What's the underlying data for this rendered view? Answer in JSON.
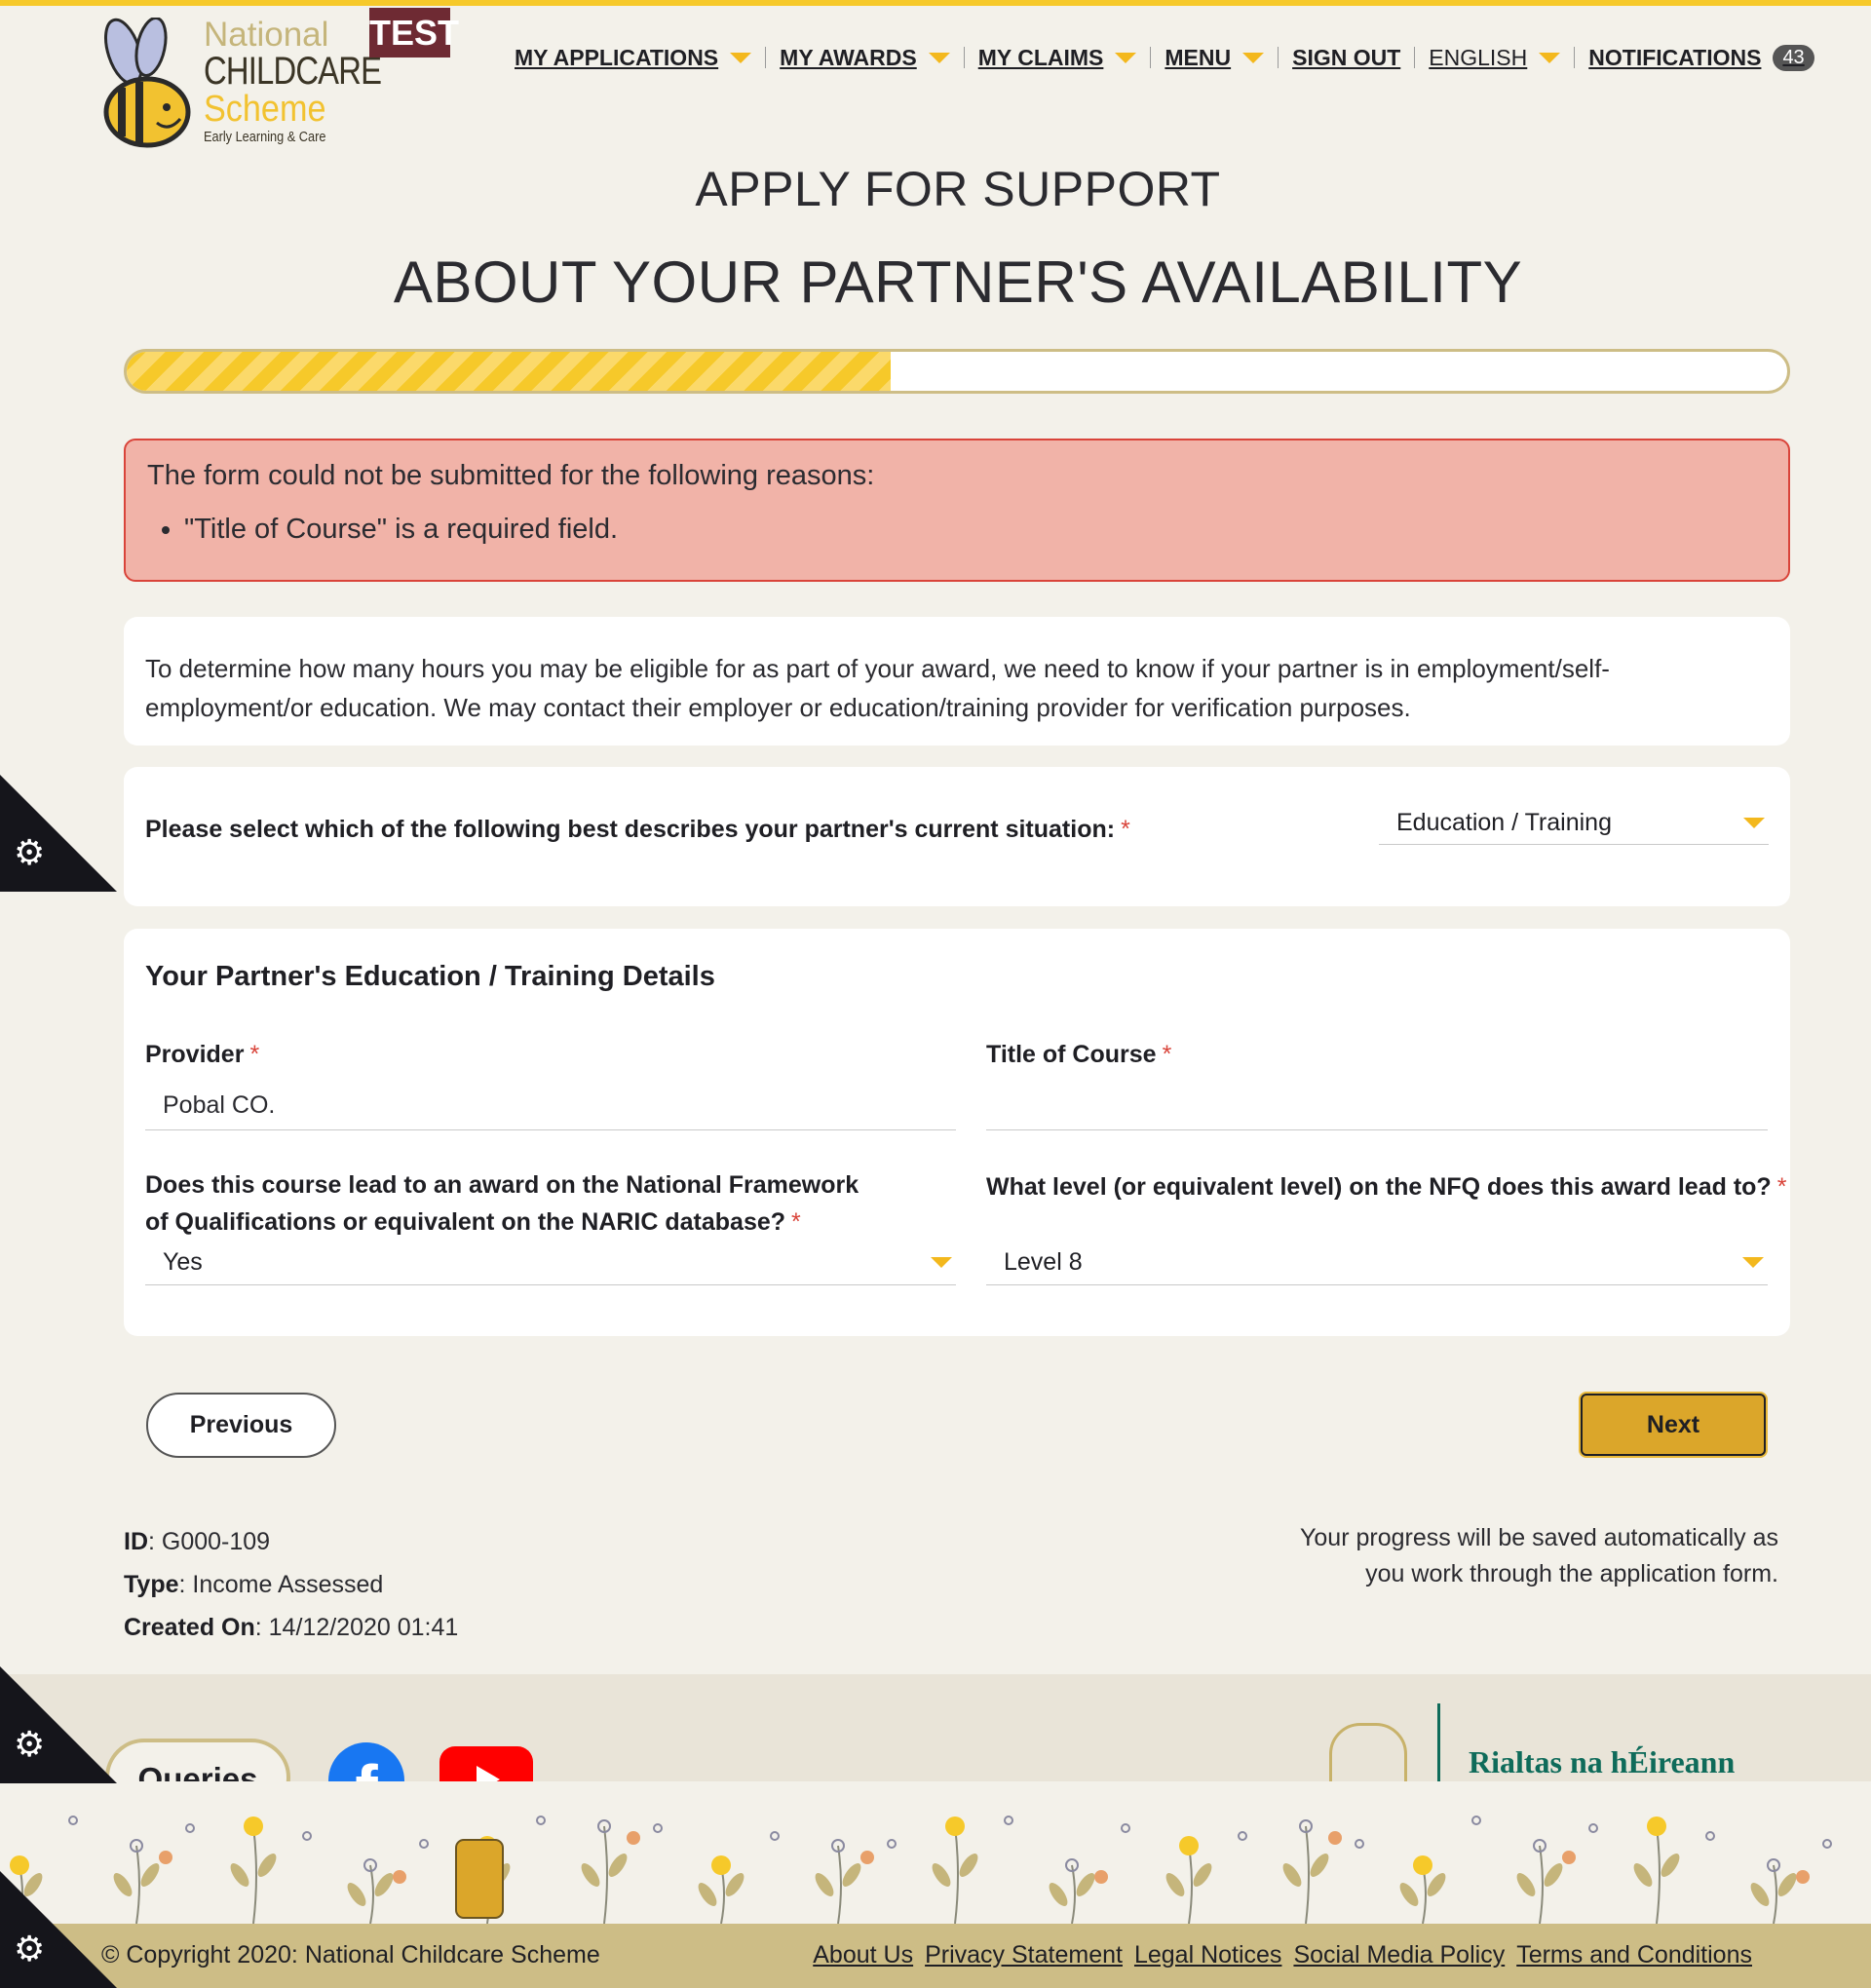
{
  "header": {
    "logo": {
      "line1": "National",
      "line2": "CHILDCARE",
      "line3": "Scheme",
      "line4": "Early Learning & Care"
    },
    "env_badge": "TEST",
    "nav": [
      {
        "label": "MY APPLICATIONS",
        "has_caret": true
      },
      {
        "label": "MY AWARDS",
        "has_caret": true
      },
      {
        "label": "MY CLAIMS",
        "has_caret": true
      },
      {
        "label": "MENU",
        "has_caret": true
      },
      {
        "label": "SIGN OUT",
        "has_caret": false
      },
      {
        "label": "ENGLISH",
        "has_caret": true
      },
      {
        "label": "NOTIFICATIONS",
        "has_caret": false
      }
    ],
    "notifications_count": "43"
  },
  "page": {
    "title": "APPLY FOR SUPPORT",
    "subtitle": "ABOUT YOUR PARTNER'S AVAILABILITY",
    "progress_percent": 46
  },
  "error": {
    "heading": "The form could not be submitted for the following reasons:",
    "items": [
      "\"Title of Course\" is a required field."
    ]
  },
  "intro": "To determine how many hours you may be eligible for as part of your award, we need to know if your partner is in employment/self-employment/or education. We may contact their employer or education/training provider for verification purposes.",
  "situation": {
    "label": "Please select which of the following best describes your partner's current situation:",
    "required_mark": "*",
    "value": "Education / Training"
  },
  "education": {
    "section_title": "Your Partner's Education / Training Details",
    "provider_label": "Provider",
    "provider_value": "Pobal CO.",
    "course_label": "Title of Course",
    "course_value": "",
    "nfq_award_label": "Does this course lead to an award on the National Framework of Qualifications or equivalent on the NARIC database?",
    "nfq_award_value": "Yes",
    "nfq_level_label": "What level (or equivalent level) on the NFQ does this award lead to?",
    "nfq_level_value": "Level 8",
    "required_mark": "*"
  },
  "buttons": {
    "previous": "Previous",
    "next": "Next"
  },
  "meta": {
    "id_label": "ID",
    "id_value": ": G000-109",
    "type_label": "Type",
    "type_value": ": Income Assessed",
    "created_label": "Created On",
    "created_value": ": 14/12/2020 01:41"
  },
  "saved_note": "Your progress will be saved automatically as you work through the application form.",
  "footer": {
    "queries": "Queries",
    "facebook_glyph": "f",
    "gov_text": "Rialtas na hÉireann",
    "copyright": "© Copyright 2020: National Childcare Scheme",
    "links": [
      "About Us",
      "Privacy Statement",
      "Legal Notices",
      "Social Media Policy",
      "Terms and Conditions"
    ]
  },
  "icons": {
    "accessibility": "gear-icon",
    "caret": "chevron-down-icon"
  },
  "colors": {
    "accent_yellow": "#f6c92a",
    "next_button": "#dba62a",
    "error_bg": "#f1b3a8",
    "error_border": "#d9443a",
    "footer_bar": "#cdbd86"
  }
}
